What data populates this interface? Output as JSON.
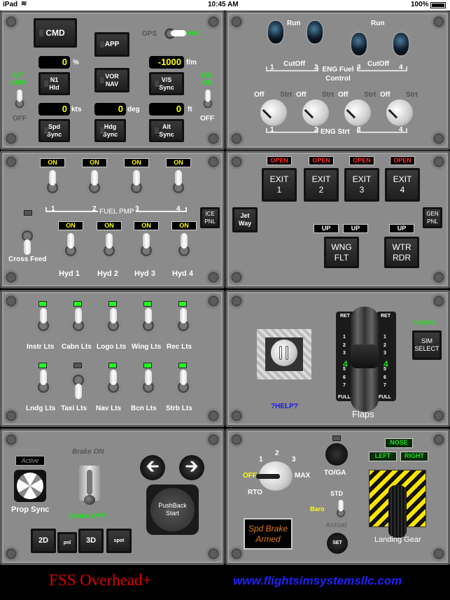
{
  "status_bar": {
    "device": "iPad",
    "time": "10:45 AM",
    "battery": "100%"
  },
  "autopilot": {
    "cmd": "CMD",
    "app": "APP",
    "gps": "GPS",
    "nav": "NAV",
    "n1_value": "0",
    "n1_unit": "%",
    "n1_hld": [
      "N1",
      "Hld"
    ],
    "vor_nav": [
      "VOR",
      "NAV"
    ],
    "vs_value": "-1000",
    "vs_unit": "f/m",
    "vs_sync": [
      "V/S",
      "Sync"
    ],
    "at_arm": [
      "A/T",
      "ARM"
    ],
    "at_off": "OFF",
    "fd_on": [
      "F/D",
      "ON"
    ],
    "fd_off": "OFF",
    "spd_value": "0",
    "spd_unit": "kts",
    "hdg_value": "0",
    "hdg_unit": "deg",
    "alt_value": "0",
    "alt_unit": "ft",
    "spd_sync": [
      "Spd",
      "Sync"
    ],
    "hdg_sync": [
      "Hdg",
      "Sync"
    ],
    "alt_sync": [
      "Alt",
      "Sync"
    ]
  },
  "engine": {
    "run": "Run",
    "cutoff": "CutOff",
    "fuel_control": [
      "ENG Fuel",
      "Control"
    ],
    "numbers": [
      "1",
      "2",
      "3",
      "4"
    ],
    "off": "Off",
    "strt": "Strt",
    "eng_strt": "ENG Strt"
  },
  "fuel": {
    "pump_status": [
      "ON",
      "ON",
      "ON",
      "ON"
    ],
    "fuel_pmp": "FUEL PMP",
    "numbers": [
      "1",
      "2",
      "3",
      "4"
    ],
    "ice_pnl": [
      "ICE",
      "PNL"
    ],
    "cross_feed": "Cross Feed",
    "hyd_status": [
      "ON",
      "ON",
      "ON",
      "ON"
    ],
    "hyd_labels": [
      "Hyd 1",
      "Hyd 2",
      "Hyd 3",
      "Hyd 4"
    ]
  },
  "doors": {
    "status": [
      "OPEN",
      "OPEN",
      "OPEN",
      "OPEN"
    ],
    "exits": [
      [
        "EXIT",
        "1"
      ],
      [
        "EXIT",
        "2"
      ],
      [
        "EXIT",
        "3"
      ],
      [
        "EXIT",
        "4"
      ]
    ],
    "jet_way": [
      "Jet",
      "Way"
    ],
    "gen_pnl": [
      "GEN",
      "PNL"
    ],
    "up": [
      "UP",
      "UP",
      "UP"
    ],
    "wng_flt": [
      "WNG",
      "FLT"
    ],
    "wtr_rdr": [
      "WTR",
      "RDR"
    ]
  },
  "lights": {
    "row1": [
      "Instr Lts",
      "Cabn Lts",
      "Logo Lts",
      "Wing Lts",
      "Rec Lts"
    ],
    "row2": [
      "Lndg Lts",
      "Taxi Lts",
      "Nav Lts",
      "Bcn Lts",
      "Strb Lts"
    ]
  },
  "flaps": {
    "help": "?HELP?",
    "ret": "RET",
    "detents": [
      "1",
      "2",
      "3",
      "4",
      "5",
      "6",
      "7"
    ],
    "selected": "4",
    "full": "FULL",
    "label": "Flaps",
    "sim": "FSX/P3D",
    "sim_select": [
      "SIM",
      "SELECT"
    ]
  },
  "ground": {
    "active": "Active",
    "prop_sync": "Prop Sync",
    "brake_on": "Brake ON",
    "brake_off": "Brake OFF",
    "pushback": [
      "PushBack",
      "Start"
    ],
    "views": [
      "2D",
      "pnl",
      "3D",
      "spot"
    ]
  },
  "gear": {
    "autobrake": {
      "one": "1",
      "two": "2",
      "three": "3",
      "off": "OFF",
      "max": "MAX",
      "rto": "RTO",
      "selected": "OFF"
    },
    "toga": "TO/GA",
    "std": "STD",
    "baro": "Baro",
    "actual": "Actual",
    "set": "SET",
    "spd_brake": [
      "Spd Brake",
      "Armed"
    ],
    "nose": "NOSE",
    "left": "LEFT",
    "right": "RIGHT",
    "landing_gear": "Landing Gear"
  },
  "footer": {
    "title": "FSS Overhead+",
    "url": "www.flightsimsystemsllc.com"
  },
  "colors": {
    "panel": "#8b8b8b",
    "indicator_green": "#1fe01f",
    "display_yellow": "#ffff00",
    "open_red": "#ff3030",
    "spd_brake_orange": "#e07a10",
    "help_blue": "#1a1adf",
    "footer_red": "#e00000",
    "footer_blue": "#2020ff"
  }
}
